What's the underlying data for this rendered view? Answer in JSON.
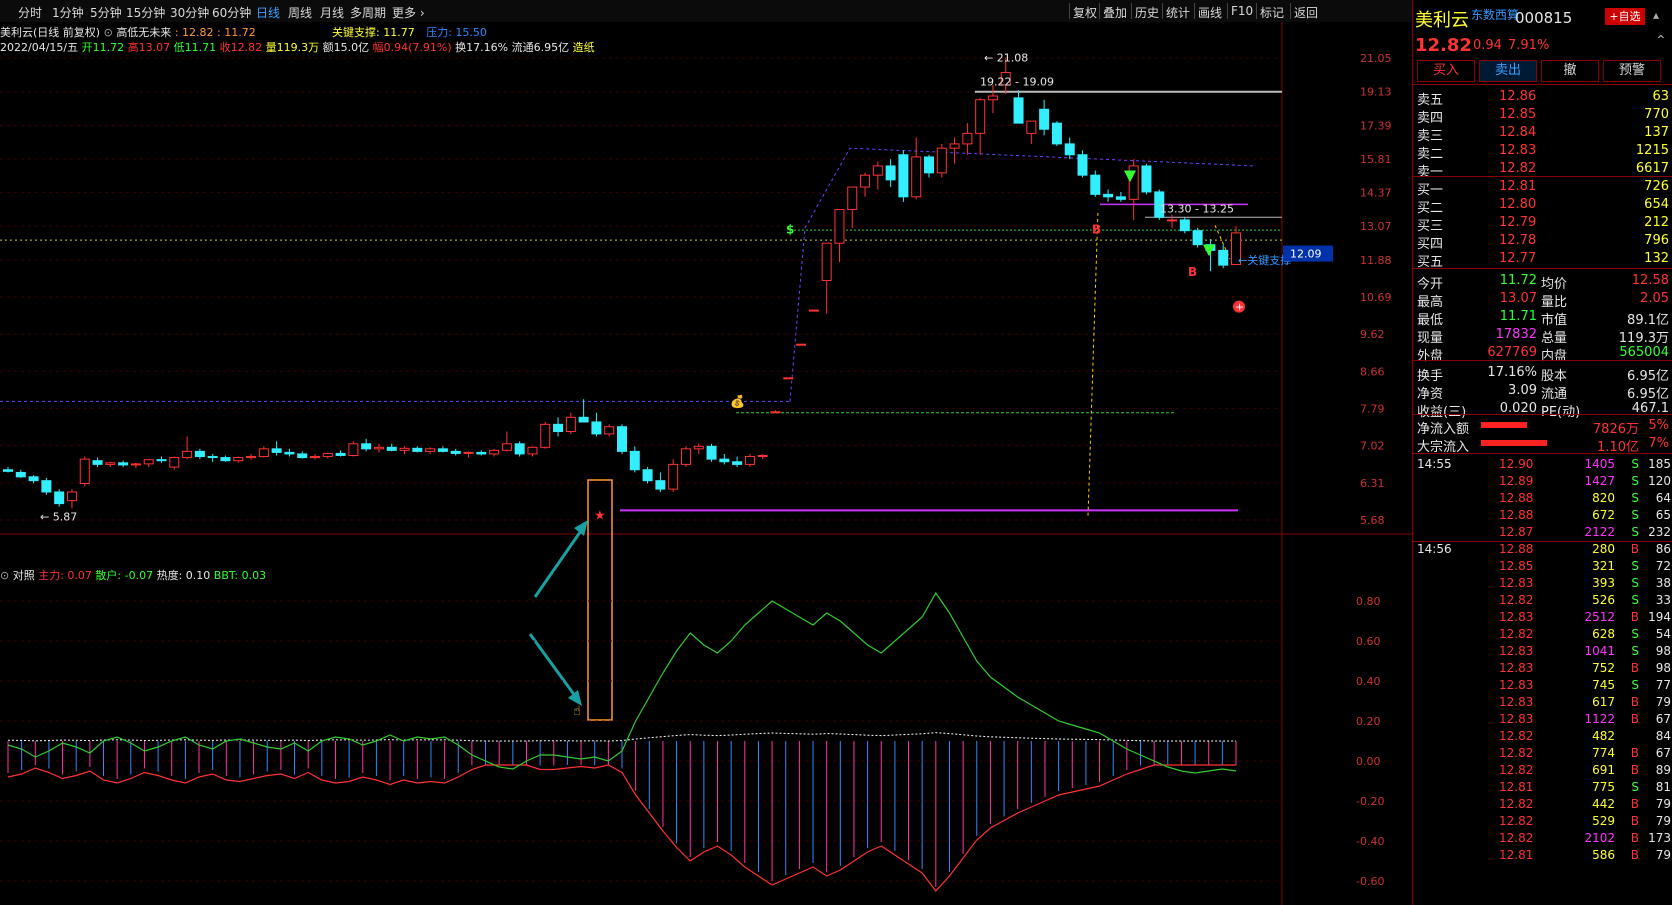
{
  "toolbar": {
    "periods": [
      "分时",
      "1分钟",
      "5分钟",
      "15分钟",
      "30分钟",
      "60分钟",
      "日线",
      "周线",
      "月线",
      "多周期",
      "更多"
    ],
    "active": "日线",
    "right_items": [
      "复权",
      "叠加",
      "历史",
      "统计",
      "画线",
      "F10",
      "标记",
      "返回"
    ]
  },
  "header": {
    "title": "美利云(日线 前复权)",
    "indicator": "高低无未来",
    "indicator_vals": ": 12.82 : 11.72",
    "support_label": "关键支撑: 11.77",
    "pressure_label": "压力: 15.50",
    "date": "2022/04/15/五",
    "open": "开11.72",
    "high": "高13.07",
    "low": "低11.71",
    "close": "收12.82",
    "volume": "量119.3万",
    "amount": "额15.0亿",
    "change": "幅0.94(7.91%)",
    "turnover": "换17.16%",
    "float": "流通6.95亿",
    "tag": "造纸"
  },
  "axis": {
    "price_ticks": [
      "21.05",
      "19.13",
      "17.39",
      "15.81",
      "14.37",
      "13.07",
      "11.88",
      "10.69",
      "9.62",
      "8.66",
      "7.79",
      "7.02",
      "6.31",
      "5.68"
    ],
    "current_price_tag": "12.09",
    "ind_ticks": [
      "0.80",
      "0.60",
      "0.40",
      "0.20",
      "0.00",
      "-0.20",
      "-0.40",
      "-0.60"
    ]
  },
  "annotations": {
    "high_label": "21.08",
    "range1": "19.22 - 19.09",
    "range2": "13.30 - 13.25",
    "low_label": "5.87",
    "support_tag": "关键支撑"
  },
  "indicator_panel": {
    "name": "对照",
    "main_label": "主力: 0.07",
    "retail_label": "散户: -0.07",
    "heat_label": "热度: 0.10",
    "bbt_label": "BBT: 0.03"
  },
  "quote": {
    "name": "美利云",
    "source": "东数西算",
    "code": "000815",
    "add_btn": "+自选",
    "price": "12.82",
    "change": "0.94",
    "pct": "7.91%",
    "buttons": [
      "买入",
      "卖出",
      "撤",
      "预警"
    ],
    "asks": [
      {
        "label": "卖五",
        "price": "12.86",
        "vol": "63"
      },
      {
        "label": "卖四",
        "price": "12.85",
        "vol": "770"
      },
      {
        "label": "卖三",
        "price": "12.84",
        "vol": "137"
      },
      {
        "label": "卖二",
        "price": "12.83",
        "vol": "1215"
      },
      {
        "label": "卖一",
        "price": "12.82",
        "vol": "6617"
      }
    ],
    "bids": [
      {
        "label": "买一",
        "price": "12.81",
        "vol": "726"
      },
      {
        "label": "买二",
        "price": "12.80",
        "vol": "654"
      },
      {
        "label": "买三",
        "price": "12.79",
        "vol": "212"
      },
      {
        "label": "买四",
        "price": "12.78",
        "vol": "796"
      },
      {
        "label": "买五",
        "price": "12.77",
        "vol": "132"
      }
    ],
    "stats": [
      {
        "l1": "今开",
        "v1": "11.72",
        "c1": "green",
        "l2": "均价",
        "v2": "12.58",
        "c2": "red"
      },
      {
        "l1": "最高",
        "v1": "13.07",
        "c1": "red",
        "l2": "量比",
        "v2": "2.05",
        "c2": "red"
      },
      {
        "l1": "最低",
        "v1": "11.71",
        "c1": "green",
        "l2": "市值",
        "v2": "89.1亿",
        "c2": "white"
      },
      {
        "l1": "现量",
        "v1": "17832",
        "c1": "magenta",
        "l2": "总量",
        "v2": "119.3万",
        "c2": "white"
      },
      {
        "l1": "外盘",
        "v1": "627769",
        "c1": "red",
        "l2": "内盘",
        "v2": "565004",
        "c2": "green"
      }
    ],
    "stats2": [
      {
        "l1": "换手",
        "v1": "17.16%",
        "l2": "股本",
        "v2": "6.95亿"
      },
      {
        "l1": "净资",
        "v1": "3.09",
        "l2": "流通",
        "v2": "6.95亿"
      },
      {
        "l1": "收益(三)",
        "v1": "0.020",
        "l2": "PE(动)",
        "v2": "467.1"
      }
    ],
    "flows": [
      {
        "label": "净流入额",
        "value": "7826万",
        "pct": "5%"
      },
      {
        "label": "大宗流入",
        "value": "1.10亿",
        "pct": "7%"
      }
    ],
    "ticks": [
      {
        "time": "14:55",
        "price": "12.90",
        "vol": "1405",
        "side": "S",
        "n": "185"
      },
      {
        "time": "",
        "price": "12.89",
        "vol": "1427",
        "side": "S",
        "n": "120"
      },
      {
        "time": "",
        "price": "12.88",
        "vol": "820",
        "side": "S",
        "n": "64"
      },
      {
        "time": "",
        "price": "12.88",
        "vol": "672",
        "side": "S",
        "n": "65"
      },
      {
        "time": "",
        "price": "12.87",
        "vol": "2122",
        "side": "S",
        "n": "232"
      },
      {
        "time": "14:56",
        "price": "12.88",
        "vol": "280",
        "side": "B",
        "n": "86"
      },
      {
        "time": "",
        "price": "12.85",
        "vol": "321",
        "side": "S",
        "n": "72"
      },
      {
        "time": "",
        "price": "12.83",
        "vol": "393",
        "side": "S",
        "n": "38"
      },
      {
        "time": "",
        "price": "12.82",
        "vol": "526",
        "side": "S",
        "n": "33"
      },
      {
        "time": "",
        "price": "12.83",
        "vol": "2512",
        "side": "B",
        "n": "194"
      },
      {
        "time": "",
        "price": "12.82",
        "vol": "628",
        "side": "S",
        "n": "54"
      },
      {
        "time": "",
        "price": "12.83",
        "vol": "1041",
        "side": "S",
        "n": "98"
      },
      {
        "time": "",
        "price": "12.83",
        "vol": "752",
        "side": "B",
        "n": "98"
      },
      {
        "time": "",
        "price": "12.83",
        "vol": "745",
        "side": "S",
        "n": "77"
      },
      {
        "time": "",
        "price": "12.83",
        "vol": "617",
        "side": "B",
        "n": "79"
      },
      {
        "time": "",
        "price": "12.83",
        "vol": "1122",
        "side": "B",
        "n": "67"
      },
      {
        "time": "",
        "price": "12.82",
        "vol": "482",
        "side": "",
        "n": "84"
      },
      {
        "time": "",
        "price": "12.82",
        "vol": "774",
        "side": "B",
        "n": "67"
      },
      {
        "time": "",
        "price": "12.82",
        "vol": "691",
        "side": "B",
        "n": "89"
      },
      {
        "time": "",
        "price": "12.81",
        "vol": "775",
        "side": "S",
        "n": "81"
      },
      {
        "time": "",
        "price": "12.82",
        "vol": "442",
        "side": "B",
        "n": "79"
      },
      {
        "time": "",
        "price": "12.82",
        "vol": "529",
        "side": "B",
        "n": "79"
      },
      {
        "time": "",
        "price": "12.82",
        "vol": "2102",
        "side": "B",
        "n": "173"
      },
      {
        "time": "",
        "price": "12.81",
        "vol": "586",
        "side": "B",
        "n": "79"
      }
    ]
  },
  "chart_data": {
    "type": "candlestick",
    "candles": [
      [
        6.55,
        6.6,
        6.5,
        6.52
      ],
      [
        6.5,
        6.55,
        6.4,
        6.42
      ],
      [
        6.42,
        6.45,
        6.3,
        6.35
      ],
      [
        6.35,
        6.4,
        6.1,
        6.15
      ],
      [
        6.15,
        6.2,
        5.9,
        5.95
      ],
      [
        6.0,
        6.2,
        5.87,
        6.15
      ],
      [
        6.3,
        6.8,
        6.25,
        6.75
      ],
      [
        6.72,
        6.78,
        6.6,
        6.65
      ],
      [
        6.65,
        6.7,
        6.6,
        6.68
      ],
      [
        6.68,
        6.72,
        6.6,
        6.64
      ],
      [
        6.64,
        6.68,
        6.58,
        6.66
      ],
      [
        6.66,
        6.75,
        6.6,
        6.74
      ],
      [
        6.74,
        6.8,
        6.68,
        6.72
      ],
      [
        6.6,
        6.8,
        6.55,
        6.78
      ],
      [
        6.78,
        7.2,
        6.75,
        6.9
      ],
      [
        6.9,
        6.95,
        6.75,
        6.8
      ],
      [
        6.8,
        6.85,
        6.7,
        6.78
      ],
      [
        6.78,
        6.82,
        6.7,
        6.72
      ],
      [
        6.72,
        6.8,
        6.68,
        6.78
      ],
      [
        6.78,
        6.85,
        6.74,
        6.8
      ],
      [
        6.8,
        7.0,
        6.78,
        6.95
      ],
      [
        6.95,
        7.1,
        6.82,
        6.88
      ],
      [
        6.88,
        6.95,
        6.8,
        6.85
      ],
      [
        6.85,
        6.9,
        6.76,
        6.78
      ],
      [
        6.78,
        6.85,
        6.74,
        6.8
      ],
      [
        6.8,
        6.88,
        6.76,
        6.86
      ],
      [
        6.86,
        6.92,
        6.8,
        6.82
      ],
      [
        6.82,
        7.1,
        6.8,
        7.05
      ],
      [
        7.05,
        7.15,
        6.9,
        6.95
      ],
      [
        6.95,
        7.05,
        6.88,
        6.98
      ],
      [
        6.98,
        7.05,
        6.9,
        6.92
      ],
      [
        6.92,
        7.0,
        6.85,
        6.96
      ],
      [
        6.96,
        7.0,
        6.88,
        6.9
      ],
      [
        6.9,
        6.98,
        6.85,
        6.95
      ],
      [
        6.95,
        7.0,
        6.88,
        6.9
      ],
      [
        6.9,
        6.95,
        6.82,
        6.86
      ],
      [
        6.86,
        6.9,
        6.78,
        6.88
      ],
      [
        6.88,
        6.92,
        6.82,
        6.85
      ],
      [
        6.85,
        6.95,
        6.8,
        6.92
      ],
      [
        6.92,
        7.3,
        6.9,
        7.05
      ],
      [
        7.05,
        7.1,
        6.8,
        6.85
      ],
      [
        6.85,
        7.0,
        6.8,
        6.98
      ],
      [
        6.98,
        7.5,
        6.95,
        7.45
      ],
      [
        7.45,
        7.6,
        7.2,
        7.3
      ],
      [
        7.3,
        7.7,
        7.25,
        7.6
      ],
      [
        7.6,
        8.0,
        7.5,
        7.5
      ],
      [
        7.5,
        7.7,
        7.2,
        7.25
      ],
      [
        7.25,
        7.45,
        7.2,
        7.4
      ],
      [
        7.4,
        7.45,
        6.85,
        6.9
      ],
      [
        6.9,
        7.0,
        6.5,
        6.55
      ],
      [
        6.55,
        6.6,
        6.3,
        6.35
      ],
      [
        6.35,
        6.5,
        6.15,
        6.2
      ],
      [
        6.2,
        6.75,
        6.15,
        6.65
      ],
      [
        6.65,
        7.0,
        6.6,
        6.95
      ],
      [
        6.95,
        7.05,
        6.85,
        7.0
      ],
      [
        7.0,
        7.05,
        6.7,
        6.75
      ],
      [
        6.75,
        6.85,
        6.65,
        6.7
      ],
      [
        6.7,
        6.8,
        6.6,
        6.65
      ],
      [
        6.65,
        6.85,
        6.6,
        6.8
      ],
      [
        6.8,
        6.85,
        6.75,
        6.82
      ],
      [
        7.7,
        7.75,
        7.7,
        7.72
      ],
      [
        8.5,
        8.5,
        8.5,
        8.5
      ],
      [
        9.35,
        9.35,
        9.35,
        9.35
      ],
      [
        10.3,
        10.3,
        10.3,
        10.3
      ],
      [
        11.2,
        11.5,
        10.2,
        12.45
      ],
      [
        12.45,
        13.3,
        11.8,
        13.7
      ],
      [
        13.7,
        14.6,
        13.0,
        14.6
      ],
      [
        14.6,
        15.2,
        14.2,
        15.1
      ],
      [
        15.1,
        15.7,
        14.5,
        15.5
      ],
      [
        15.5,
        15.8,
        14.6,
        14.9
      ],
      [
        16.0,
        16.2,
        14.0,
        14.2
      ],
      [
        14.2,
        16.8,
        14.1,
        15.9
      ],
      [
        15.9,
        16.0,
        15.0,
        15.2
      ],
      [
        15.2,
        16.5,
        15.0,
        16.3
      ],
      [
        16.3,
        16.8,
        15.6,
        16.5
      ],
      [
        16.5,
        17.5,
        16.0,
        17.0
      ],
      [
        17.0,
        18.8,
        16.0,
        18.7
      ],
      [
        18.7,
        19.5,
        18.0,
        18.9
      ],
      [
        19.5,
        21.08,
        19.0,
        20.2
      ],
      [
        18.8,
        19.22,
        17.5,
        17.5
      ],
      [
        17.0,
        17.5,
        16.5,
        17.6
      ],
      [
        18.2,
        18.7,
        16.9,
        17.2
      ],
      [
        17.5,
        17.6,
        16.4,
        16.5
      ],
      [
        16.5,
        16.8,
        15.8,
        16.0
      ],
      [
        16.0,
        16.2,
        15.0,
        15.1
      ],
      [
        15.1,
        15.3,
        14.2,
        14.3
      ],
      [
        14.3,
        14.5,
        14.0,
        14.2
      ],
      [
        14.2,
        14.4,
        14.0,
        14.1
      ],
      [
        14.1,
        15.8,
        13.3,
        15.5
      ],
      [
        15.5,
        15.6,
        14.3,
        14.4
      ],
      [
        14.4,
        14.5,
        13.3,
        13.4
      ],
      [
        13.3,
        13.5,
        13.0,
        13.3
      ],
      [
        13.3,
        13.4,
        12.8,
        12.9
      ],
      [
        12.9,
        13.0,
        12.3,
        12.4
      ],
      [
        12.4,
        12.6,
        11.5,
        12.2
      ],
      [
        12.2,
        12.4,
        11.6,
        11.7
      ],
      [
        11.72,
        13.07,
        11.71,
        12.82
      ]
    ],
    "ind": [
      0.08,
      0.06,
      0.02,
      0.05,
      0.09,
      0.07,
      0.04,
      0.1,
      0.12,
      0.09,
      0.05,
      0.07,
      0.1,
      0.12,
      0.08,
      0.06,
      0.1,
      0.11,
      0.09,
      0.07,
      0.06,
      0.09,
      0.05,
      0.1,
      0.12,
      0.11,
      0.08,
      0.1,
      0.13,
      0.1,
      0.12,
      0.11,
      0.12,
      0.08,
      0.03,
      0.0,
      -0.03,
      -0.04,
      0.0,
      0.03,
      0.03,
      0.02,
      0.01,
      0.02,
      0.0,
      0.05,
      0.2,
      0.32,
      0.44,
      0.55,
      0.64,
      0.58,
      0.54,
      0.6,
      0.68,
      0.74,
      0.8,
      0.76,
      0.72,
      0.68,
      0.74,
      0.7,
      0.64,
      0.58,
      0.54,
      0.6,
      0.66,
      0.72,
      0.84,
      0.74,
      0.62,
      0.5,
      0.42,
      0.37,
      0.32,
      0.28,
      0.24,
      0.2,
      0.18,
      0.16,
      0.14,
      0.1,
      0.06,
      0.03,
      0.0,
      -0.03,
      -0.05,
      -0.06,
      -0.05,
      -0.04,
      -0.05
    ],
    "ylim": [
      5.68,
      21.05
    ]
  }
}
